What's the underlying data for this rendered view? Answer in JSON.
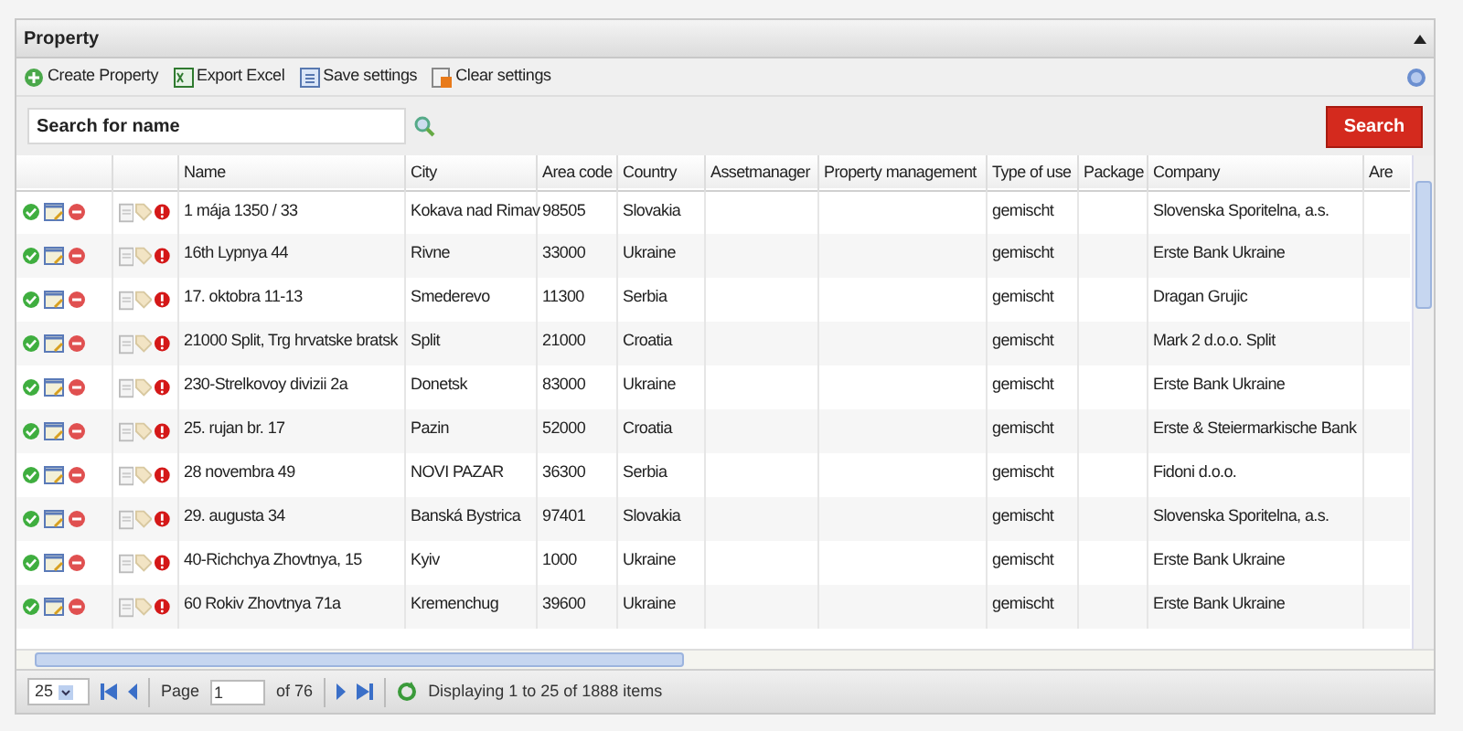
{
  "panel": {
    "title": "Property"
  },
  "toolbar": [
    {
      "label": "Create Property",
      "kind": "create"
    },
    {
      "label": "Export Excel",
      "kind": "excel"
    },
    {
      "label": "Save settings",
      "kind": "save"
    },
    {
      "label": "Clear settings",
      "kind": "clear"
    }
  ],
  "search": {
    "placeholder": "Search for name",
    "button": "Search"
  },
  "columns": [
    "Name",
    "City",
    "Area code",
    "Country",
    "Assetmanager",
    "Property management",
    "Type of use",
    "Package",
    "Company",
    "Are"
  ],
  "rows": [
    {
      "name": "1 mája 1350 / 33",
      "city": "Kokava nad Rimav",
      "area_code": "98505",
      "country": "Slovakia",
      "type_of_use": "gemischt",
      "company": "Slovenska Sporitelna, a.s."
    },
    {
      "name": "16th Lypnya 44",
      "city": "Rivne",
      "area_code": "33000",
      "country": "Ukraine",
      "type_of_use": "gemischt",
      "company": "Erste Bank Ukraine"
    },
    {
      "name": "17. oktobra 11-13",
      "city": "Smederevo",
      "area_code": "11300",
      "country": "Serbia",
      "type_of_use": "gemischt",
      "company": "Dragan Grujic"
    },
    {
      "name": "21000 Split, Trg hrvatske bratsk",
      "city": "Split",
      "area_code": "21000",
      "country": "Croatia",
      "type_of_use": "gemischt",
      "company": "Mark 2 d.o.o. Split"
    },
    {
      "name": "230-Strelkovoy divizii 2a",
      "city": "Donetsk",
      "area_code": "83000",
      "country": "Ukraine",
      "type_of_use": "gemischt",
      "company": "Erste Bank Ukraine"
    },
    {
      "name": "25. rujan br. 17",
      "city": "Pazin",
      "area_code": "52000",
      "country": "Croatia",
      "type_of_use": "gemischt",
      "company": "Erste & Steiermarkische Bank"
    },
    {
      "name": "28 novembra 49",
      "city": "NOVI PAZAR",
      "area_code": "36300",
      "country": "Serbia",
      "type_of_use": "gemischt",
      "company": "Fidoni d.o.o."
    },
    {
      "name": "29. augusta 34",
      "city": "Banská Bystrica",
      "area_code": "97401",
      "country": "Slovakia",
      "type_of_use": "gemischt",
      "company": "Slovenska Sporitelna, a.s."
    },
    {
      "name": "40-Richchya Zhovtnya, 15",
      "city": "Kyiv",
      "area_code": "1000",
      "country": "Ukraine",
      "type_of_use": "gemischt",
      "company": "Erste Bank Ukraine"
    },
    {
      "name": "60 Rokiv Zhovtnya 71a",
      "city": "Kremenchug",
      "area_code": "39600",
      "country": "Ukraine",
      "type_of_use": "gemischt",
      "company": "Erste Bank Ukraine"
    }
  ],
  "pager": {
    "page_size": "25",
    "page_label": "Page",
    "page": "1",
    "of": "of 76",
    "status": "Displaying 1 to 25 of 1888 items"
  }
}
